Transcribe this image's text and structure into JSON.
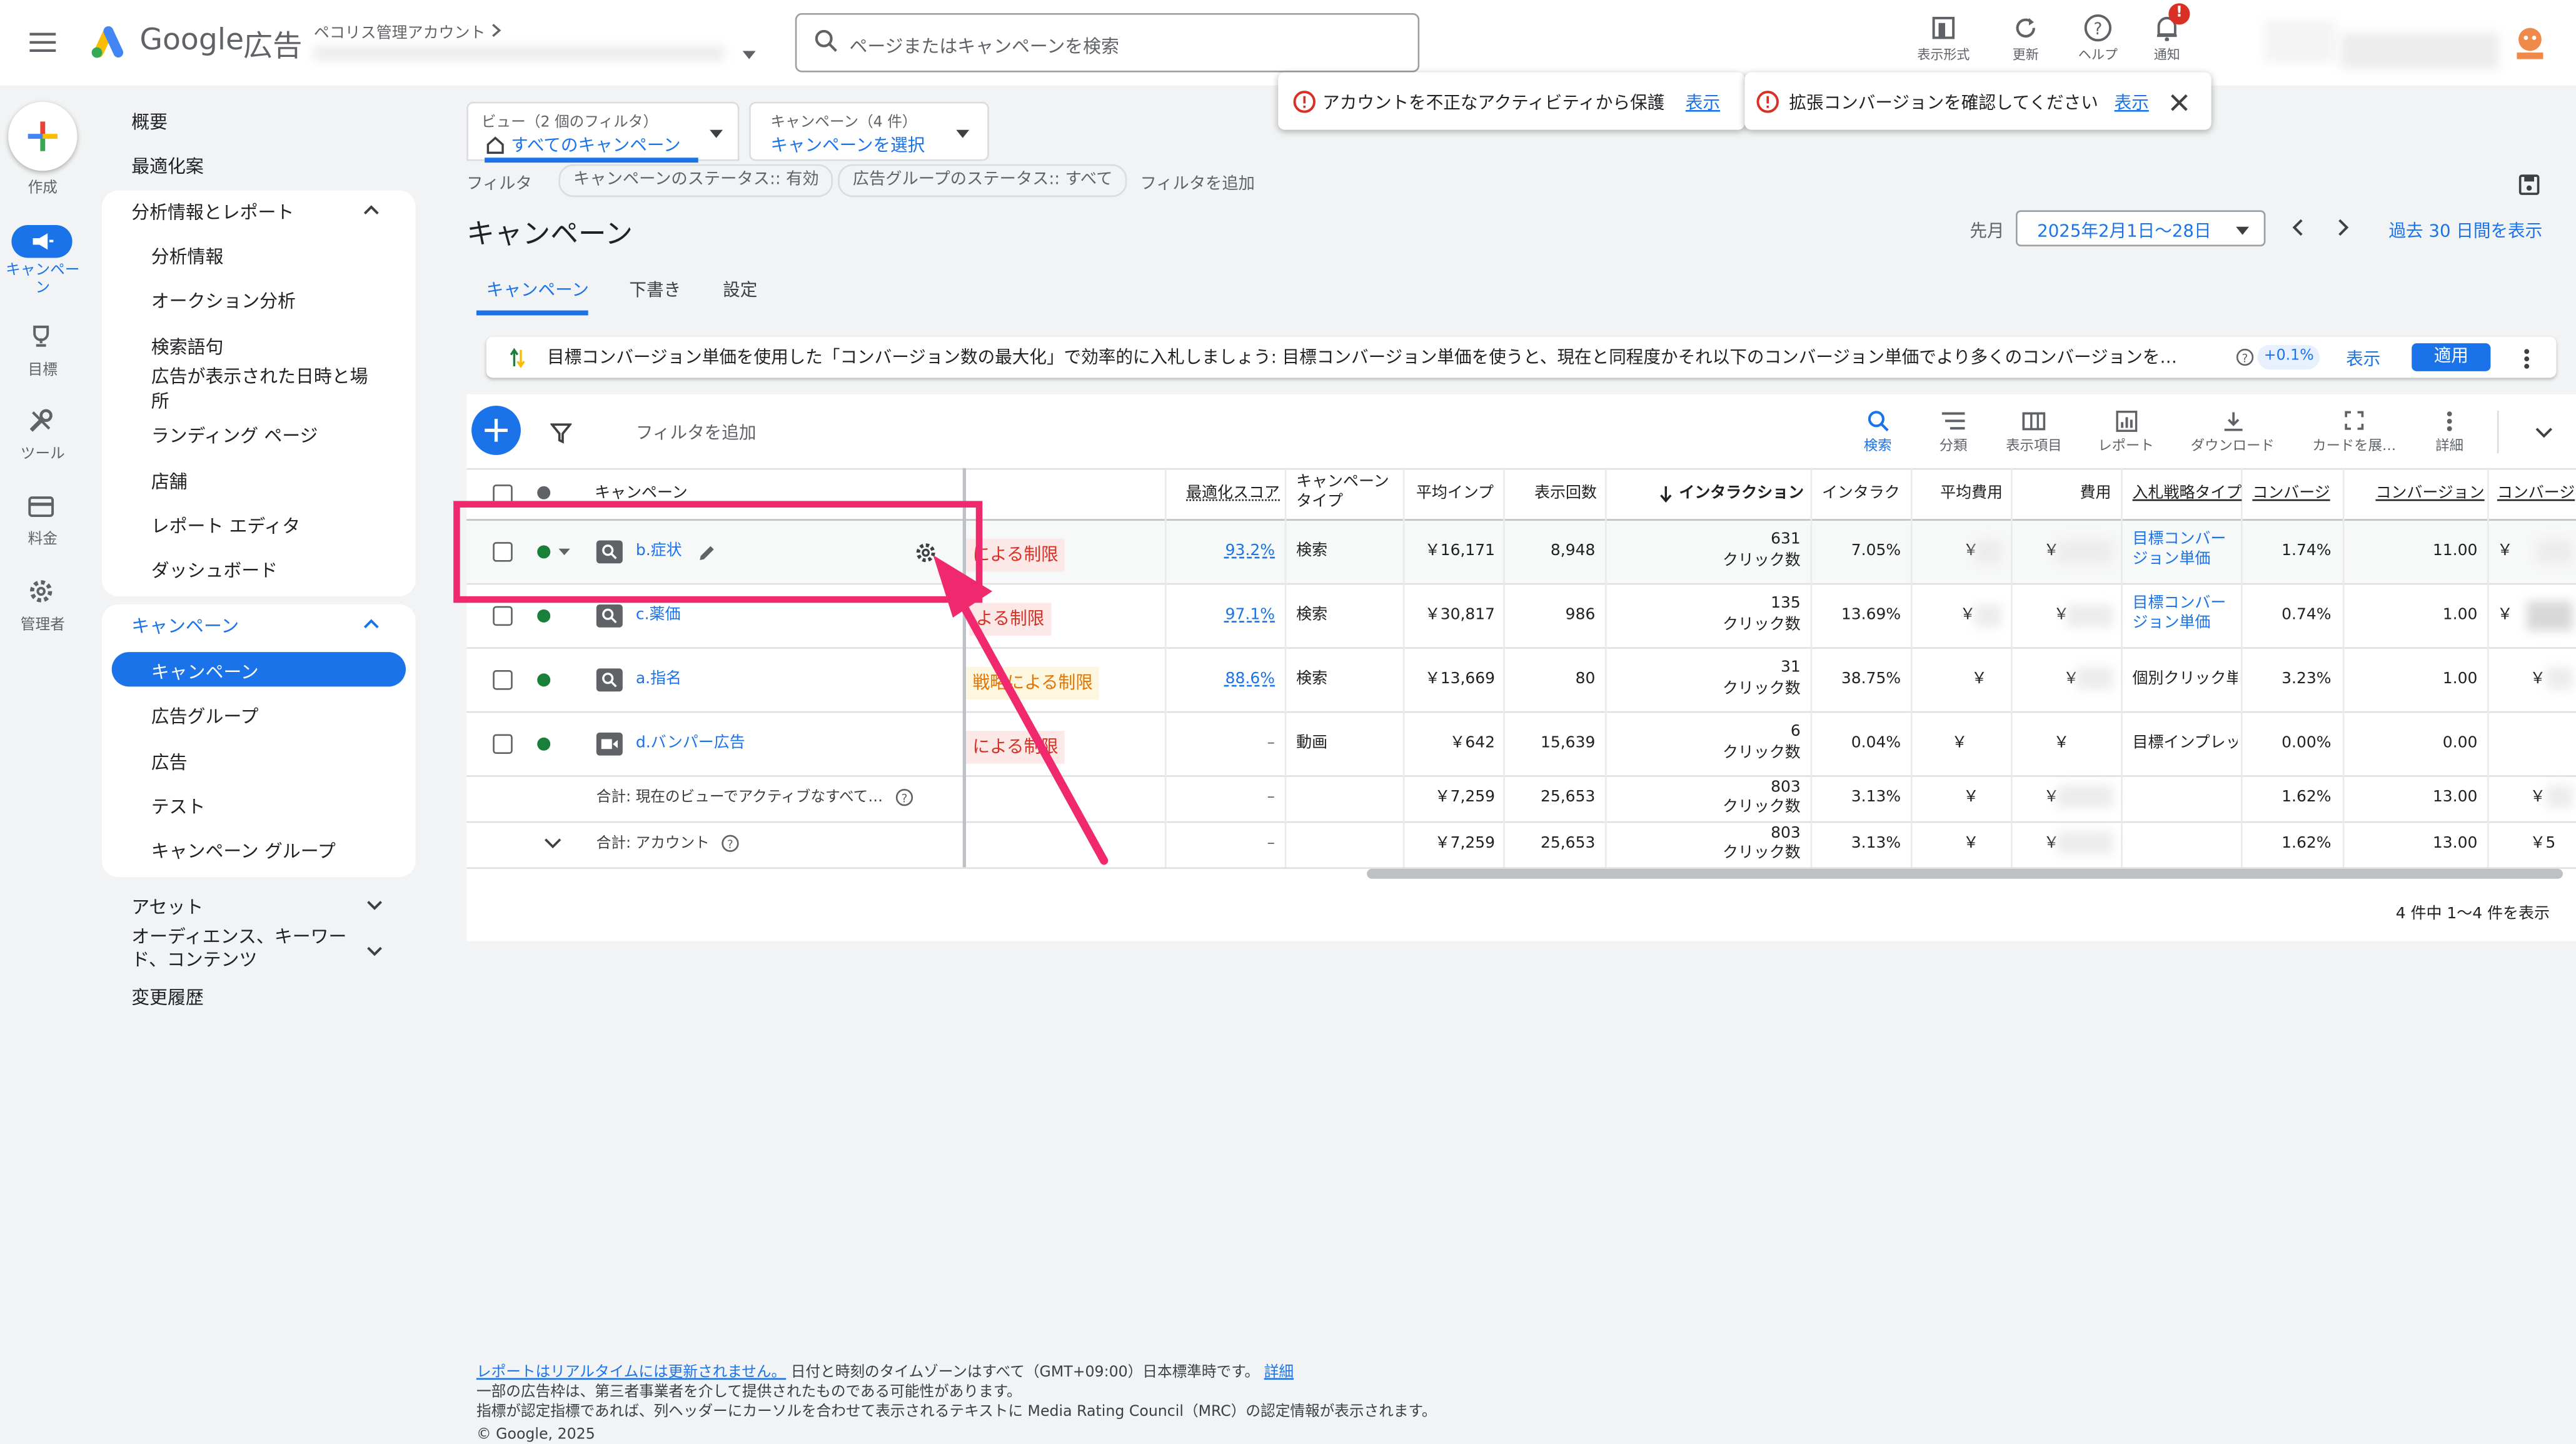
{
  "header": {
    "product_google": "Google",
    "product_ads": "広告",
    "account_label": "ペコリス管理アカウント",
    "search_placeholder": "ページまたはキャンペーンを検索",
    "toolbar": [
      {
        "label": "表示形式",
        "icon": "display-format-icon"
      },
      {
        "label": "更新",
        "icon": "refresh-icon"
      },
      {
        "label": "ヘルプ",
        "icon": "help-icon"
      },
      {
        "label": "通知",
        "icon": "bell-icon",
        "badge": "!"
      }
    ]
  },
  "notifications": [
    {
      "text": "アカウントを不正なアクティビティから保護",
      "link": "表示"
    },
    {
      "text": "拡張コンバージョンを確認してください",
      "link": "表示"
    }
  ],
  "rail": [
    {
      "label": "作成",
      "icon": "create-plus-icon"
    },
    {
      "label": "キャンペーン",
      "icon": "megaphone-icon",
      "active": true
    },
    {
      "label": "目標",
      "icon": "trophy-icon"
    },
    {
      "label": "ツール",
      "icon": "tools-icon"
    },
    {
      "label": "料金",
      "icon": "billing-card-icon"
    },
    {
      "label": "管理者",
      "icon": "admin-gear-icon"
    }
  ],
  "nav": {
    "overview": "概要",
    "recommendations": "最適化案",
    "insights": {
      "title": "分析情報とレポート",
      "items": [
        "分析情報",
        "オークション分析",
        "検索語句",
        "広告が表示された日時と場所",
        "ランディング ページ",
        "店舗",
        "レポート エディタ",
        "ダッシュボード"
      ]
    },
    "campaigns": {
      "title": "キャンペーン",
      "items": [
        "キャンペーン",
        "広告グループ",
        "広告",
        "テスト",
        "キャンペーン グループ"
      ]
    },
    "assets": "アセット",
    "audiences": "オーディエンス、キーワード、コンテンツ",
    "change_history": "変更履歴"
  },
  "filters": {
    "view_label": "ビュー（2 個のフィルタ）",
    "view_value": "すべてのキャンペーン",
    "campaign_label": "キャンペーン（4 件）",
    "campaign_value": "キャンペーンを選択",
    "filter_label": "フィルタ",
    "chips": [
      "キャンペーンのステータス:: 有効",
      "広告グループのステータス:: すべて"
    ],
    "add_filter": "フィルタを追加"
  },
  "page": {
    "title": "キャンペーン",
    "date_prefix": "先月",
    "date_range": "2025年2月1日～28日",
    "past30": "過去 30 日間を表示",
    "tabs": [
      "キャンペーン",
      "下書き",
      "設定"
    ]
  },
  "banner": {
    "text": "目標コンバージョン単価を使用した「コンバージョン数の最大化」で効率的に入札しましょう: 目標コンバージョン単価を使うと、現在と同程度かそれ以下のコンバージョン単価でより多くのコンバージョンを…",
    "delta": "+0.1%",
    "view": "表示",
    "apply": "適用"
  },
  "table_toolbar": {
    "add_filter": "フィルタを追加",
    "tools": [
      {
        "label": "検索",
        "icon": "search-icon"
      },
      {
        "label": "分類",
        "icon": "segment-icon"
      },
      {
        "label": "表示項目",
        "icon": "columns-icon"
      },
      {
        "label": "レポート",
        "icon": "report-chart-icon"
      },
      {
        "label": "ダウンロード",
        "icon": "download-icon"
      },
      {
        "label": "カードを展…",
        "icon": "expand-icon"
      },
      {
        "label": "詳細",
        "icon": "more-vert-icon"
      }
    ]
  },
  "table": {
    "columns": {
      "campaign": "キャンペーン",
      "opt_score": "最適化スコア",
      "type": "キャンペーン\nタイプ",
      "avg_imp": "平均インプ",
      "impressions": "表示回数",
      "interactions": "インタラクション",
      "int_rate": "インタラク",
      "avg_cost": "平均費用",
      "cost": "費用",
      "bid": "入札戦略タイプ",
      "conv_rate": "コンバージ",
      "conversions": "コンバージョン",
      "conv_extra": "コンバージ"
    },
    "rows": [
      {
        "name": "b.症状",
        "status": "による制限",
        "score": "93.2%",
        "type": "検索",
        "avg_imp": "￥16,171",
        "impressions": "8,948",
        "interactions": "631",
        "int_unit": "クリック数",
        "int_rate": "7.05%",
        "avg_cost": "￥",
        "cost": "￥",
        "bid": "目標コンバー\nジョン単価",
        "conv_rate": "1.74%",
        "conversions": "11.00",
        "extra": "￥",
        "icon": "search-campaign-icon"
      },
      {
        "name": "c.薬価",
        "status": "よる制限",
        "score": "97.1%",
        "type": "検索",
        "avg_imp": "￥30,817",
        "impressions": "986",
        "interactions": "135",
        "int_unit": "クリック数",
        "int_rate": "13.69%",
        "avg_cost": "￥",
        "cost": "￥",
        "bid": "目標コンバー\nジョン単価",
        "conv_rate": "0.74%",
        "conversions": "1.00",
        "extra": "￥",
        "icon": "search-campaign-icon"
      },
      {
        "name": "a.指名",
        "status": "戦略による制限",
        "score": "88.6%",
        "type": "検索",
        "avg_imp": "￥13,669",
        "impressions": "80",
        "interactions": "31",
        "int_unit": "クリック数",
        "int_rate": "38.75%",
        "avg_cost": "￥",
        "cost": "￥",
        "bid": "個別クリック単価",
        "conv_rate": "3.23%",
        "conversions": "1.00",
        "extra": "￥",
        "icon": "search-campaign-icon"
      },
      {
        "name": "d.バンパー広告",
        "status": "による制限",
        "score": "–",
        "type": "動画",
        "avg_imp": "￥642",
        "impressions": "15,639",
        "interactions": "6",
        "int_unit": "クリック数",
        "int_rate": "0.04%",
        "avg_cost": "￥",
        "cost": "￥",
        "bid": "目標インプレッ",
        "conv_rate": "0.00%",
        "conversions": "0.00",
        "extra": "",
        "icon": "video-campaign-icon"
      }
    ],
    "totals": [
      {
        "label": "合計: 現在のビューでアクティブなすべて…",
        "score": "–",
        "avg_imp": "￥7,259",
        "impressions": "25,653",
        "interactions": "803",
        "int_unit": "クリック数",
        "int_rate": "3.13%",
        "avg_cost": "￥",
        "cost": "￥",
        "conv_rate": "1.62%",
        "conversions": "13.00",
        "extra": "￥"
      },
      {
        "label": "合計: アカウント",
        "score": "–",
        "avg_imp": "￥7,259",
        "impressions": "25,653",
        "interactions": "803",
        "int_unit": "クリック数",
        "int_rate": "3.13%",
        "avg_cost": "￥",
        "cost": "￥",
        "conv_rate": "1.62%",
        "conversions": "13.00",
        "extra": "￥5"
      }
    ],
    "pagination": "4 件中 1～4 件を表示"
  },
  "footer": {
    "realtime_link": "レポートはリアルタイムには更新されません。",
    "timezone": "日付と時刻のタイムゾーンはすべて（GMT+09:00）日本標準時です。",
    "details": "詳細",
    "line2": "一部の広告枠は、第三者事業者を介して提供されたものである可能性があります。",
    "line3": "指標が認定指標であれば、列ヘッダーにカーソルを合わせて表示されるテキストに Media Rating Council（MRC）の認定情報が表示されます。",
    "copyright": "© Google, 2025"
  },
  "colors": {
    "accent": "#1a73e8",
    "annotation": "#f0286e",
    "status_red": "#d93025",
    "status_orange": "#e37400",
    "enabled_green": "#188038"
  }
}
